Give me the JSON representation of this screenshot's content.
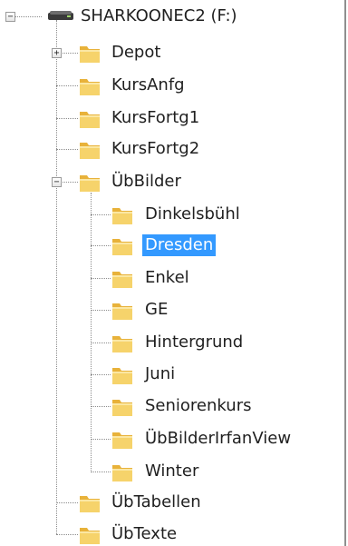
{
  "tree": {
    "drive": {
      "label": "SHARKOONEC2 (F:)",
      "expanded": true
    },
    "items": [
      {
        "label": "Depot",
        "expander": "+"
      },
      {
        "label": "KursAnfg"
      },
      {
        "label": "KursFortg1"
      },
      {
        "label": "KursFortg2"
      },
      {
        "label": "ÜbBilder",
        "expander": "−"
      },
      {
        "label": "Dinkelsbühl"
      },
      {
        "label": "Dresden",
        "selected": true
      },
      {
        "label": "Enkel"
      },
      {
        "label": "GE"
      },
      {
        "label": "Hintergrund"
      },
      {
        "label": "Juni"
      },
      {
        "label": "Seniorenkurs"
      },
      {
        "label": "ÜbBilderIrfanView"
      },
      {
        "label": "Winter"
      },
      {
        "label": "ÜbTabellen"
      },
      {
        "label": "ÜbTexte"
      }
    ]
  },
  "colors": {
    "selection": "#3399ff",
    "folder": "#f4c542"
  }
}
